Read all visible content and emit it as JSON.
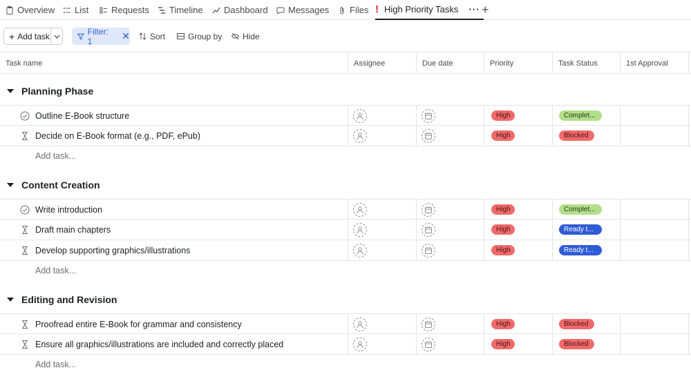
{
  "tabs": [
    {
      "label": "Overview",
      "icon": "clipboard-icon"
    },
    {
      "label": "List",
      "icon": "list-icon"
    },
    {
      "label": "Requests",
      "icon": "requests-icon"
    },
    {
      "label": "Timeline",
      "icon": "timeline-icon"
    },
    {
      "label": "Dashboard",
      "icon": "dashboard-icon"
    },
    {
      "label": "Messages",
      "icon": "messages-icon"
    },
    {
      "label": "Files",
      "icon": "paperclip-icon"
    },
    {
      "label": "High Priority Tasks",
      "icon": "exclamation-icon",
      "active": true
    }
  ],
  "toolbar": {
    "add_task": "Add task",
    "filter": "Filter: 1",
    "sort": "Sort",
    "group_by": "Group by",
    "hide": "Hide"
  },
  "columns": [
    "Task name",
    "Assignee",
    "Due date",
    "Priority",
    "Task Status",
    "1st Approval"
  ],
  "add_task_row": "Add task...",
  "sections": [
    {
      "title": "Planning Phase",
      "tasks": [
        {
          "name": "Outline E-Book structure",
          "icon": "check-circle-icon",
          "priority": "High",
          "status": "Complet...",
          "status_kind": "complete"
        },
        {
          "name": "Decide on E-Book format (e.g., PDF, ePub)",
          "icon": "hourglass-icon",
          "priority": "High",
          "status": "Blocked",
          "status_kind": "blocked"
        }
      ]
    },
    {
      "title": "Content Creation",
      "tasks": [
        {
          "name": "Write introduction",
          "icon": "check-circle-icon",
          "priority": "High",
          "status": "Complet...",
          "status_kind": "complete"
        },
        {
          "name": "Draft main chapters",
          "icon": "hourglass-icon",
          "priority": "High",
          "status": "Ready t...",
          "status_kind": "ready"
        },
        {
          "name": "Develop supporting graphics/illustrations",
          "icon": "hourglass-icon",
          "priority": "High",
          "status": "Ready t...",
          "status_kind": "ready"
        }
      ]
    },
    {
      "title": "Editing and Revision",
      "tasks": [
        {
          "name": "Proofread entire E-Book for grammar and consistency",
          "icon": "hourglass-icon",
          "priority": "High",
          "status": "Blocked",
          "status_kind": "blocked"
        },
        {
          "name": "Ensure all graphics/illustrations are included and correctly placed",
          "icon": "hourglass-icon",
          "priority": "High",
          "status": "Blocked",
          "status_kind": "blocked"
        }
      ]
    }
  ]
}
